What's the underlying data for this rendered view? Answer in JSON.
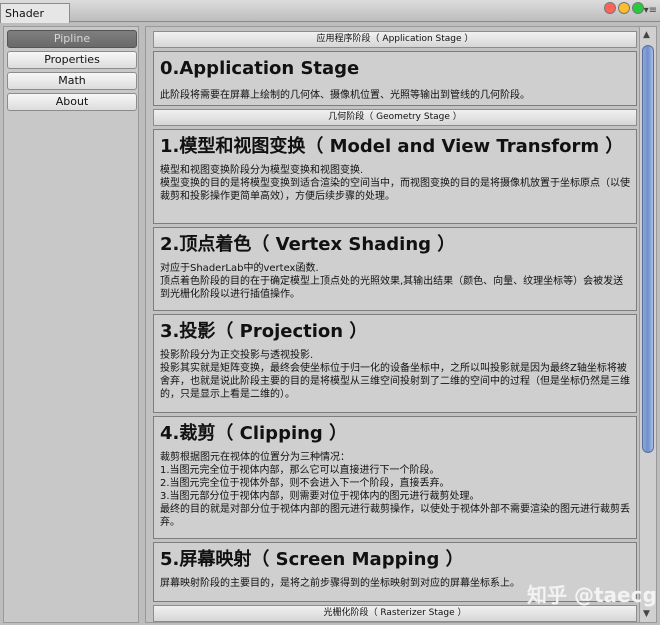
{
  "window": {
    "tab_title": "Shader"
  },
  "sidebar": {
    "items": [
      {
        "label": "Pipline",
        "active": true
      },
      {
        "label": "Properties",
        "active": false
      },
      {
        "label": "Math",
        "active": false
      },
      {
        "label": "About",
        "active": false
      }
    ]
  },
  "main": {
    "sections": {
      "application_header": "应用程序阶段（ Application Stage ）",
      "geometry_header": "几何阶段（ Geometry Stage ）",
      "rasterizer_header": "光栅化阶段（ Rasterizer Stage ）"
    },
    "cards": [
      {
        "title": "0.Application Stage",
        "body": "此阶段将需要在屏幕上绘制的几何体、摄像机位置、光照等输出到管线的几何阶段。"
      },
      {
        "title": "1.模型和视图变换（ Model and View Transform ）",
        "body": "模型和视图变换阶段分为模型变换和视图变换.\n模型变换的目的是将模型变换到适合渲染的空间当中，而视图变换的目的是将摄像机放置于坐标原点（以使裁剪和投影操作更简单高效），方便后续步骤的处理。"
      },
      {
        "title": "2.顶点着色（ Vertex Shading ）",
        "body": "对应于ShaderLab中的vertex函数.\n顶点着色阶段的目的在于确定模型上顶点处的光照效果,其输出结果（颜色、向量、纹理坐标等）会被发送到光栅化阶段以进行插值操作。"
      },
      {
        "title": "3.投影（ Projection ）",
        "body": "投影阶段分为正交投影与透视投影.\n投影其实就是矩阵变换，最终会使坐标位于归一化的设备坐标中，之所以叫投影就是因为最终Z轴坐标将被舍弃，也就是说此阶段主要的目的是将模型从三维空间投射到了二维的空间中的过程（但是坐标仍然是三维的，只是显示上看是二维的）。"
      },
      {
        "title": "4.裁剪（ Clipping ）",
        "body": "裁剪根据图元在视体的位置分为三种情况：\n1.当图元完全位于视体内部，那么它可以直接进行下一个阶段。\n2.当图元完全位于视体外部，则不会进入下一个阶段，直接丢弃。\n3.当图元部分位于视体内部，则需要对位于视体内的图元进行裁剪处理。\n最终的目的就是对部分位于视体内部的图元进行裁剪操作，以使处于视体外部不需要渲染的图元进行裁剪丢弃。"
      },
      {
        "title": "5.屏幕映射（ Screen Mapping ）",
        "body": "屏幕映射阶段的主要目的，是将之前步骤得到的坐标映射到对应的屏幕坐标系上。"
      }
    ]
  },
  "watermark": "知乎 @taecg"
}
